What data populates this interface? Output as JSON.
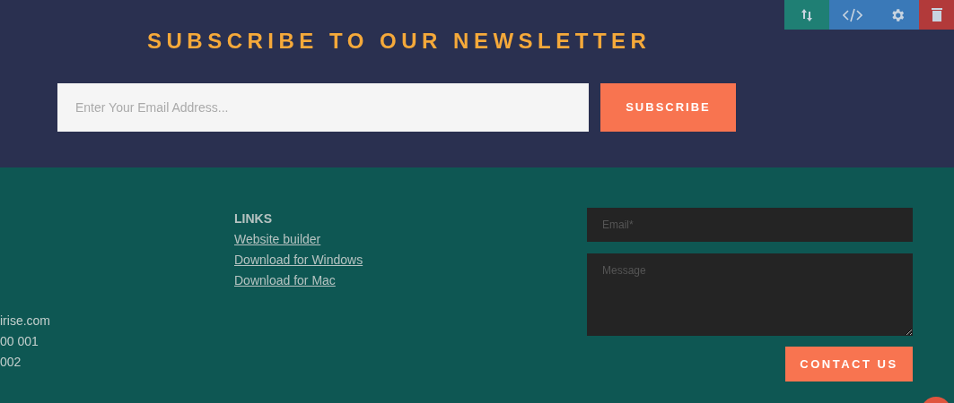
{
  "toolbar": [
    {
      "kind": "move"
    },
    {
      "kind": "code"
    },
    {
      "kind": "settings"
    },
    {
      "kind": "delete"
    }
  ],
  "newsletter": {
    "title": "SUBSCRIBE TO OUR NEWSLETTER",
    "email_placeholder": "Enter Your Email Address...",
    "button": "SUBSCRIBE"
  },
  "contacts": [
    "irise.com",
    "00 001",
    "002"
  ],
  "links": {
    "heading": "LINKS",
    "items": [
      "Website builder",
      "Download for Windows",
      "Download for Mac"
    ]
  },
  "form": {
    "email_placeholder": "Email*",
    "message_placeholder": "Message",
    "button": "CONTACT US"
  }
}
